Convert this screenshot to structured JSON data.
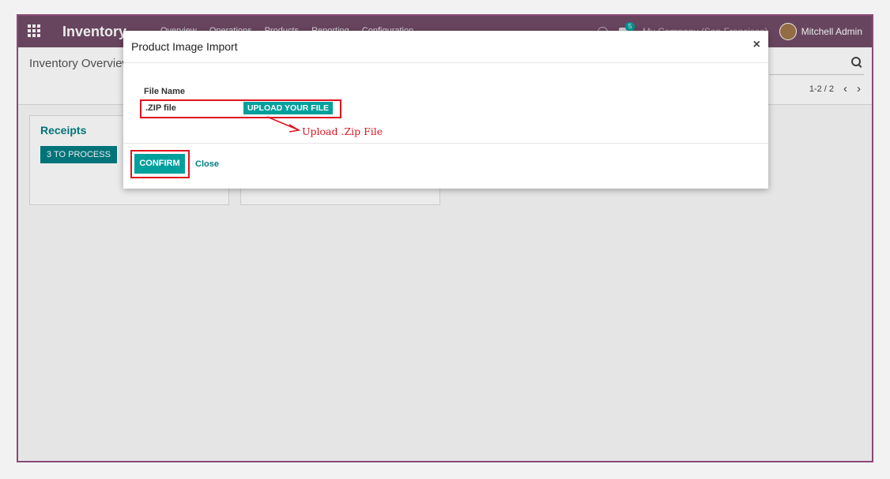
{
  "navbar": {
    "app_name": "Inventory",
    "menu_items": [
      "Overview",
      "Operations",
      "Products",
      "Reporting",
      "Configuration"
    ],
    "chat_count": "5",
    "company": "My Company (San Francisco)",
    "user_name": "Mitchell Admin"
  },
  "control_panel": {
    "breadcrumb": "Inventory Overview",
    "pager_value": "1-2 / 2",
    "prev_glyph": "‹",
    "next_glyph": "›"
  },
  "cards": [
    {
      "title": "Receipts",
      "button_label": "3 TO PROCESS"
    },
    {
      "title": "",
      "button_label": ""
    }
  ],
  "dialog": {
    "title": "Product Image Import",
    "close_glyph": "×",
    "field_label": "File Name",
    "file_value": ".ZIP file",
    "upload_label": "UPLOAD YOUR FILE",
    "annotation": "Upload .Zip File",
    "confirm_label": "CONFIRM",
    "close_label": "Close"
  },
  "colors": {
    "navbar": "#714b67",
    "accent": "#00a09d",
    "highlight": "#e0141e"
  }
}
